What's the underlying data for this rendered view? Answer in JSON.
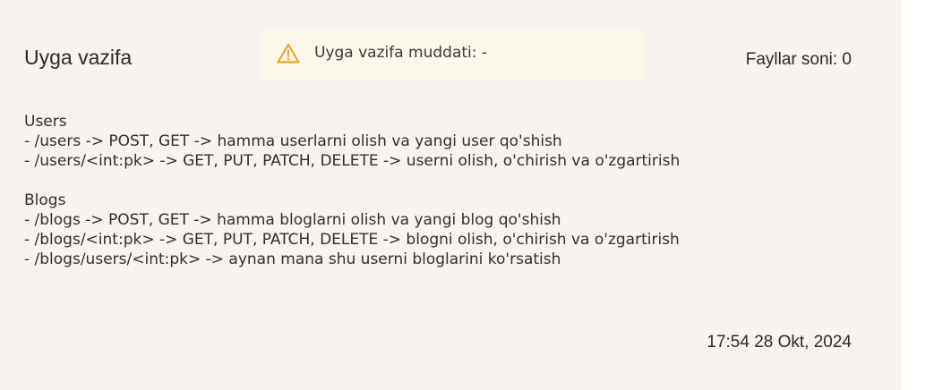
{
  "card": {
    "title": "Uyga vazifa",
    "deadline": {
      "icon": "warning-triangle-icon",
      "icon_color": "#e8a82c",
      "text": "Uyga vazifa muddati: -"
    },
    "files_count": "Fayllar soni: 0",
    "description": {
      "sections": [
        {
          "heading": "Users",
          "lines": [
            "- /users -> POST, GET -> hamma userlarni olish va yangi user qo'shish",
            "- /users/<int:pk> -> GET, PUT, PATCH, DELETE -> userni olish, o'chirish va o'zgartirish"
          ]
        },
        {
          "heading": "Blogs",
          "lines": [
            "- /blogs -> POST, GET -> hamma bloglarni olish va yangi blog qo'shish",
            "- /blogs/<int:pk> -> GET, PUT, PATCH, DELETE -> blogni olish, o'chirish va o'zgartirish",
            "- /blogs/users/<int:pk> -> aynan mana shu userni bloglarini ko'rsatish"
          ]
        }
      ]
    },
    "timestamp": "17:54 28 Okt, 2024"
  }
}
